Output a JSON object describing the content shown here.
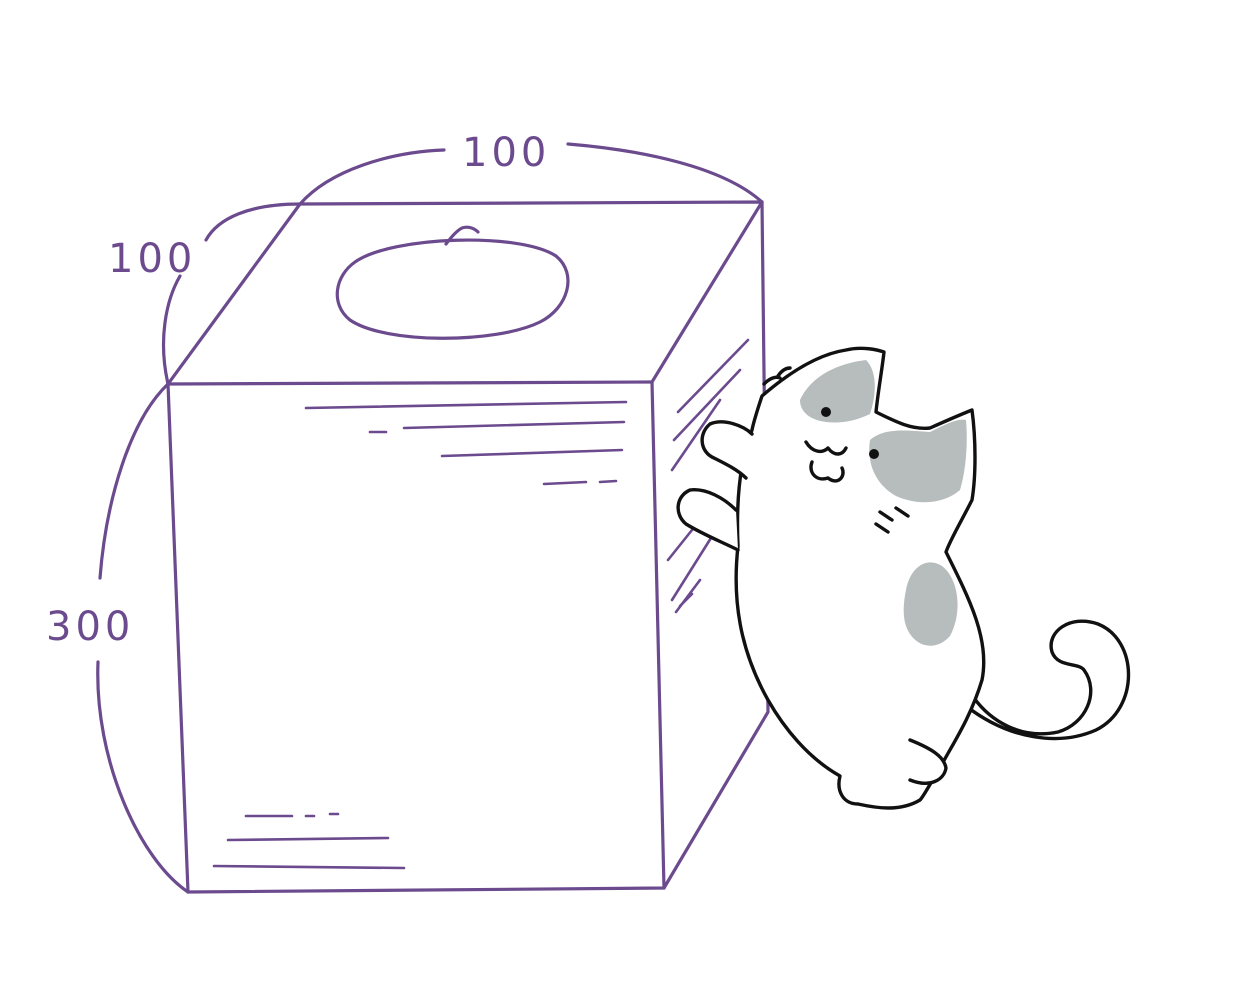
{
  "colors": {
    "box_stroke": "#6b4a8e",
    "cat_outline": "#111111",
    "cat_patch": "#b7bcbc",
    "background": "#ffffff"
  },
  "labels": {
    "width": "100",
    "depth": "100",
    "height": "300"
  }
}
